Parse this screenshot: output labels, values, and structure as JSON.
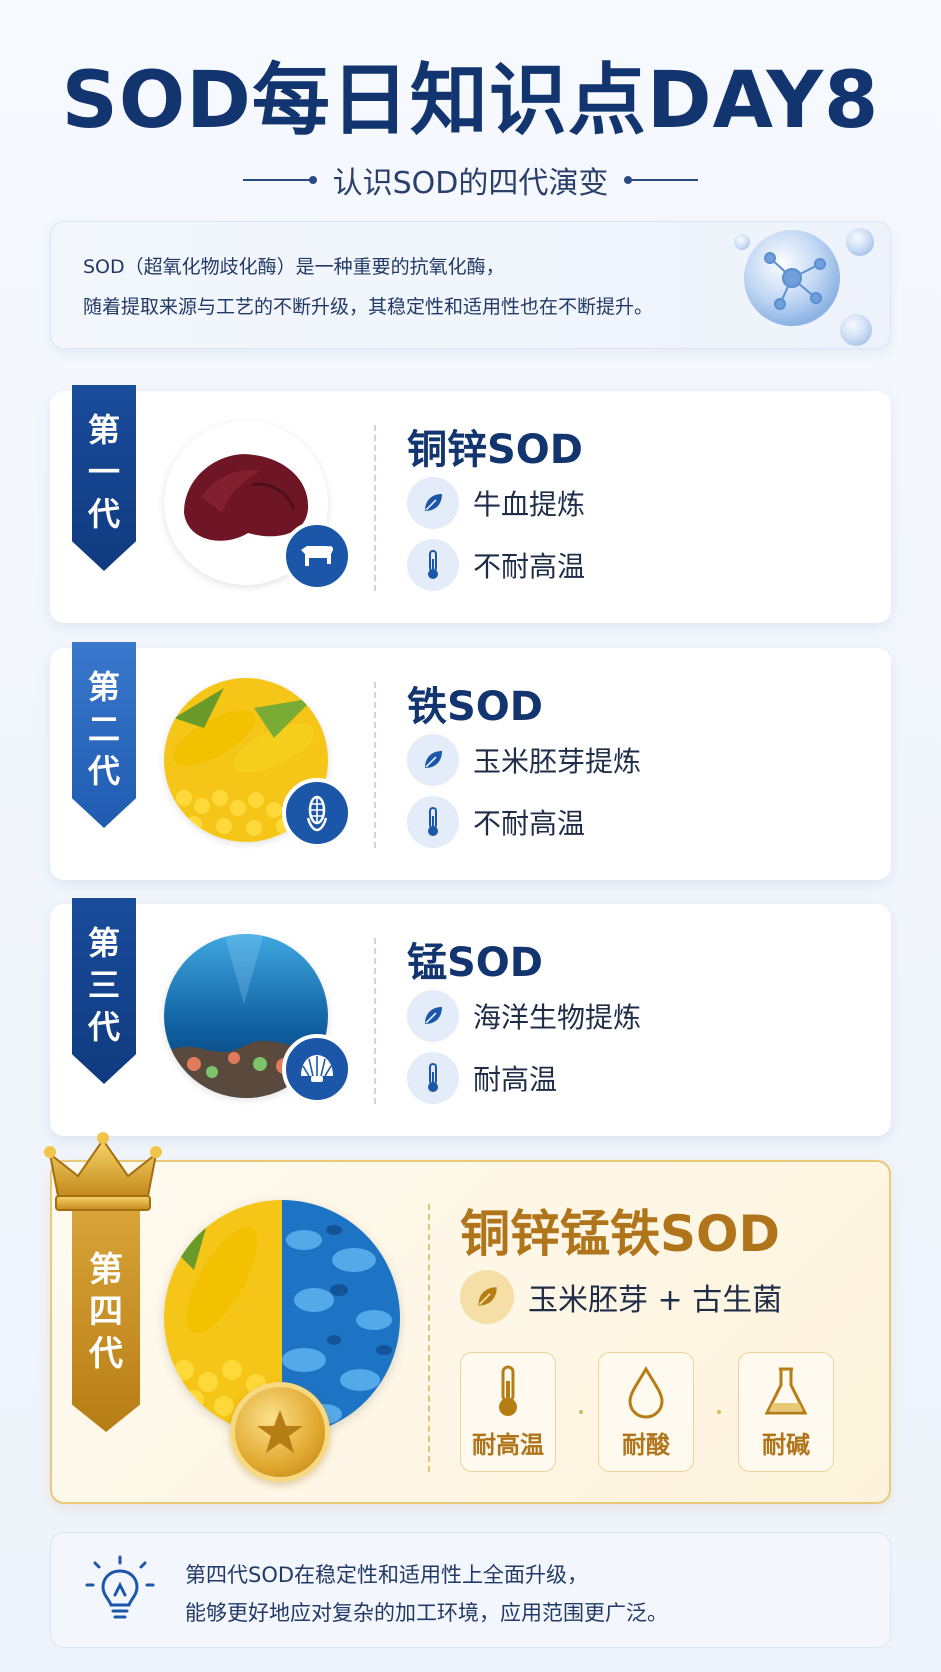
{
  "header": {
    "title": "SOD每日知识点DAY8",
    "subtitle": "认识SOD的四代演变"
  },
  "intro": {
    "line1": "SOD（超氧化物歧化酶）是一种重要的抗氧化酶，",
    "line2": "随着提取来源与工艺的不断升级，其稳定性和适用性也在不断提升。"
  },
  "generations": [
    {
      "gen": [
        "第",
        "一",
        "代"
      ],
      "name": "铜锌SOD",
      "source": "牛血提炼",
      "heat": "不耐高温",
      "badge_icon": "cow-icon"
    },
    {
      "gen": [
        "第",
        "二",
        "代"
      ],
      "name": "铁SOD",
      "source": "玉米胚芽提炼",
      "heat": "不耐高温",
      "badge_icon": "corn-icon"
    },
    {
      "gen": [
        "第",
        "三",
        "代"
      ],
      "name": "锰SOD",
      "source": "海洋生物提炼",
      "heat": "耐高温",
      "badge_icon": "shell-icon"
    }
  ],
  "fourth": {
    "gen": [
      "第",
      "四",
      "代"
    ],
    "name": "铜锌锰铁SOD",
    "source": "玉米胚芽 + 古生菌",
    "props": [
      "耐高温",
      "耐酸",
      "耐碱"
    ]
  },
  "note": {
    "line1": "第四代SOD在稳定性和适用性上全面升级，",
    "line2": "能够更好地应对复杂的加工环境，应用范围更广泛。"
  },
  "colors": {
    "navy": "#13356f",
    "gold": "#b0751a",
    "accent_blue": "#1c56a8"
  }
}
